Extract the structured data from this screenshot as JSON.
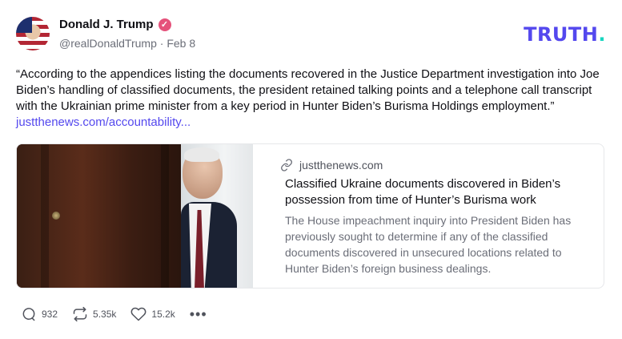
{
  "author": {
    "name": "Donald J. Trump",
    "handle": "@realDonaldTrump",
    "separator": "·",
    "date": "Feb 8"
  },
  "brand": {
    "logo_text": "TRUTH",
    "logo_dot": ".",
    "accent_color": "#5448ee",
    "dot_color": "#18d6c0",
    "verified_color": "#e5527b"
  },
  "post": {
    "text": "“According to the appendices listing the documents recovered in the Justice Department investigation into Joe Biden’s handling of classified documents, the president retained talking points and a telephone call transcript with the Ukrainian prime minister from a key period in Hunter Biden’s Burisma Holdings employment.” ",
    "link_text": "justthenews.com/accountability..."
  },
  "card": {
    "domain": "justthenews.com",
    "title": "Classified Ukraine documents discovered in Biden’s possession from time of Hunter’s Burisma work",
    "description": "The House impeachment inquiry into President Biden has previously sought to determine if any of the classified documents discovered in unsecured locations related to Hunter Biden’s foreign business dealings."
  },
  "actions": {
    "replies": "932",
    "retruths": "5.35k",
    "likes": "15.2k",
    "more": "•••"
  }
}
